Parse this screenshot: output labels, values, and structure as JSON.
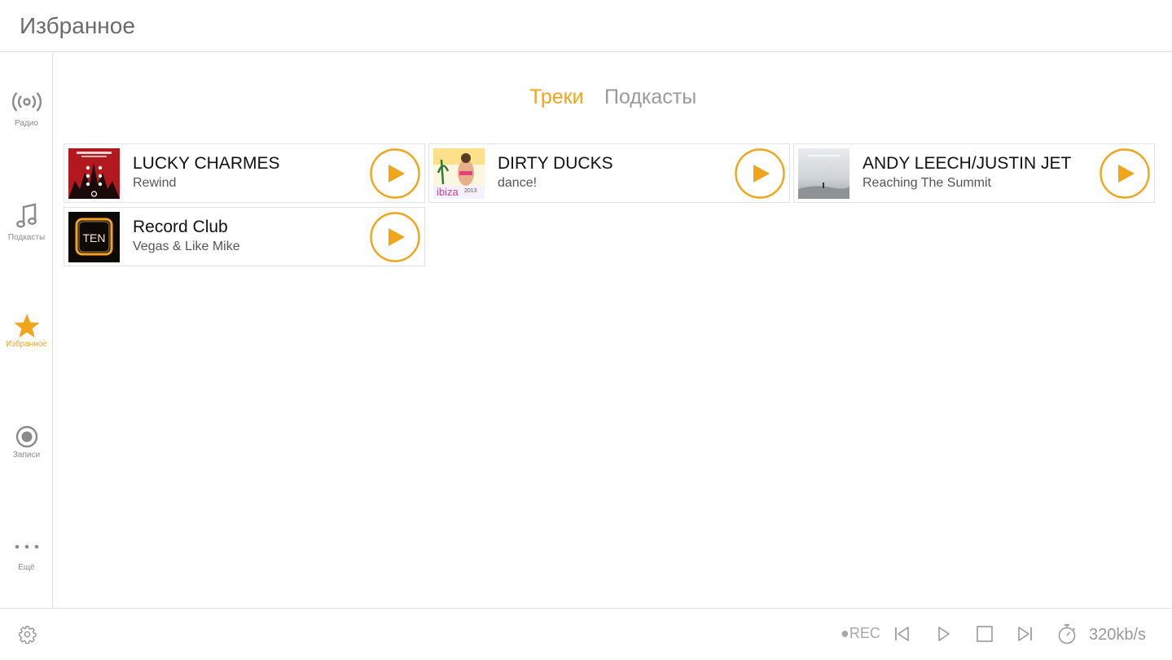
{
  "header": {
    "title": "Избранное"
  },
  "sidebar": {
    "items": [
      {
        "label": "Радио",
        "icon": "radio-broadcast-icon"
      },
      {
        "label": "Подкасты",
        "icon": "music-note-icon"
      },
      {
        "label": "Избранное",
        "icon": "star-icon",
        "active": true
      },
      {
        "label": "Записи",
        "icon": "record-icon"
      },
      {
        "label": "Ещё",
        "icon": "more-dots-icon"
      }
    ]
  },
  "tabs": [
    {
      "label": "Треки",
      "active": true
    },
    {
      "label": "Подкасты",
      "active": false
    }
  ],
  "tracks": [
    {
      "title": "LUCKY CHARMES",
      "subtitle": "Rewind",
      "cover_text": "LUCKY CHARMES REWIND EP"
    },
    {
      "title": "DIRTY DUCKS",
      "subtitle": "dance!",
      "cover_text": "ibiza 2013"
    },
    {
      "title": "ANDY LEECH/JUSTIN JET",
      "subtitle": "Reaching The Summit",
      "cover_text": ""
    },
    {
      "title": "Record Club",
      "subtitle": "Vegas & Like Mike",
      "cover_text": "TEN"
    }
  ],
  "player": {
    "rec_label": "●REC",
    "bitrate": "320kb/s"
  },
  "colors": {
    "accent": "#f0a51a",
    "muted": "#9a9a9a"
  }
}
